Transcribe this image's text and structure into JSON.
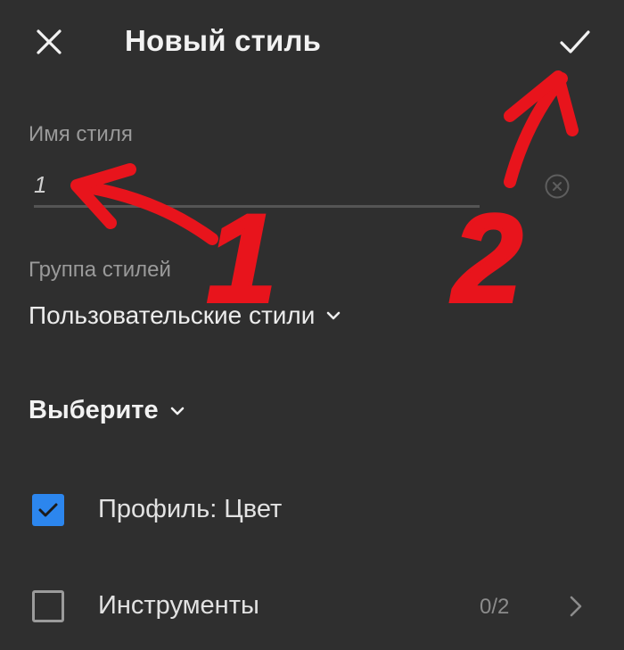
{
  "header": {
    "title": "Новый стиль",
    "close_icon": "close-icon",
    "confirm_icon": "checkmark-icon"
  },
  "name_field": {
    "label": "Имя стиля",
    "value": "1",
    "clear_icon": "clear-circle-icon"
  },
  "group_field": {
    "label": "Группа стилей",
    "selected": "Пользовательские стили",
    "icon": "chevron-down-icon"
  },
  "select_menu": {
    "label": "Выберите",
    "icon": "chevron-down-icon"
  },
  "options": [
    {
      "label": "Профиль: Цвет",
      "checked": true
    },
    {
      "label": "Инструменты",
      "checked": false,
      "count": "0/2",
      "icon": "chevron-right-icon"
    }
  ],
  "annotations": {
    "color": "#e8141c",
    "marker_1": "1",
    "marker_2": "2"
  },
  "colors": {
    "background": "#2f2f2f",
    "accent": "#2c86ee",
    "text_primary": "#f2f2f2",
    "text_secondary": "#9a9a9a"
  }
}
